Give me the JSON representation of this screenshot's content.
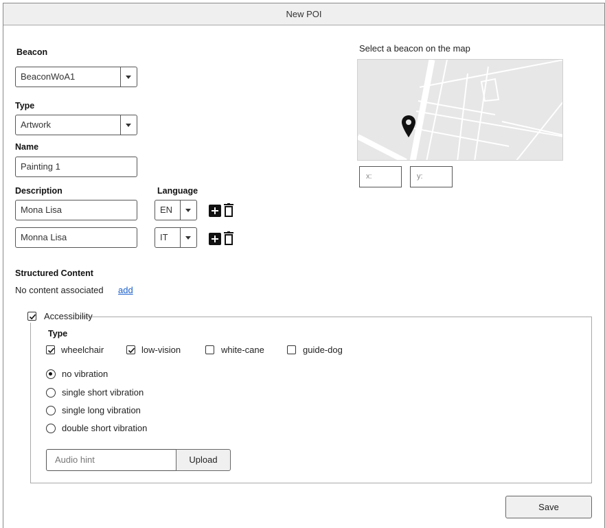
{
  "window": {
    "title": "New POI"
  },
  "beacon": {
    "label": "Beacon",
    "value": "BeaconWoA1"
  },
  "type": {
    "label": "Type",
    "value": "Artwork"
  },
  "name": {
    "label": "Name",
    "value": "Painting 1"
  },
  "description": {
    "label": "Description",
    "language_label": "Language",
    "rows": [
      {
        "text": "Mona Lisa",
        "language": "EN"
      },
      {
        "text": "Monna Lisa",
        "language": "IT"
      }
    ]
  },
  "map": {
    "label": "Select a beacon on the map",
    "x_placeholder": "x:",
    "y_placeholder": "y:",
    "marker_icon": "map-pin-icon"
  },
  "structured_content": {
    "label": "Structured Content",
    "empty_text": "No content associated",
    "add_link": "add"
  },
  "accessibility": {
    "label": "Accessibility",
    "checked": true,
    "type_label": "Type",
    "types": [
      {
        "label": "wheelchair",
        "checked": true
      },
      {
        "label": "low-vision",
        "checked": true
      },
      {
        "label": "white-cane",
        "checked": false
      },
      {
        "label": "guide-dog",
        "checked": false
      }
    ],
    "vibrations": [
      {
        "label": "no vibration",
        "selected": true
      },
      {
        "label": "single short vibration",
        "selected": false
      },
      {
        "label": "single long vibration",
        "selected": false
      },
      {
        "label": "double short vibration",
        "selected": false
      }
    ],
    "audio_hint_placeholder": "Audio hint",
    "upload_label": "Upload"
  },
  "save_label": "Save",
  "colors": {
    "link": "#1a5fcc",
    "titlebar": "#efefef",
    "map_bg": "#e7e7e7"
  }
}
